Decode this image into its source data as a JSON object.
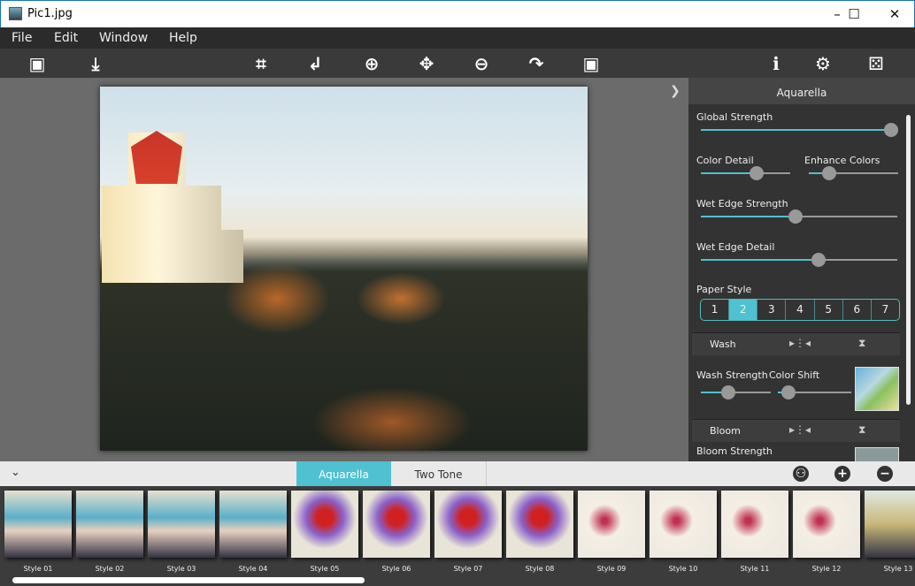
{
  "window": {
    "title": "Pic1.jpg",
    "minimize": "–",
    "maximize": "☐",
    "close": "✕"
  },
  "menu": [
    "File",
    "Edit",
    "Window",
    "Help"
  ],
  "toolbar": {
    "left": [
      {
        "icon": "open-image-icon",
        "glyph": "▣"
      },
      {
        "icon": "save-icon",
        "glyph": "⤓"
      }
    ],
    "center": [
      {
        "icon": "crop-icon",
        "glyph": "⌗"
      },
      {
        "icon": "undo-icon",
        "glyph": "↲"
      },
      {
        "icon": "zoom-in-icon",
        "glyph": "⊕"
      },
      {
        "icon": "pan-icon",
        "glyph": "✥"
      },
      {
        "icon": "zoom-out-icon",
        "glyph": "⊖"
      },
      {
        "icon": "redo-icon",
        "glyph": "↷"
      },
      {
        "icon": "fit-image-icon",
        "glyph": "▣"
      }
    ],
    "right": [
      {
        "icon": "info-icon",
        "glyph": "ℹ"
      },
      {
        "icon": "settings-icon",
        "glyph": "⚙"
      },
      {
        "icon": "random-dice-icon",
        "glyph": "⚄"
      }
    ]
  },
  "panel": {
    "title": "Aquarella",
    "sliders": {
      "global_strength": {
        "label": "Global Strength",
        "value": 0.97
      },
      "color_detail": {
        "label": "Color Detail",
        "value": 0.62
      },
      "enhance_colors": {
        "label": "Enhance Colors",
        "value": 0.23
      },
      "wet_edge_strength": {
        "label": "Wet Edge Strength",
        "value": 0.48
      },
      "wet_edge_detail": {
        "label": "Wet Edge Detail",
        "value": 0.6
      },
      "wash_strength": {
        "label": "Wash Strength",
        "value": 0.39
      },
      "color_shift": {
        "label": "Color Shift",
        "value": 0.14
      }
    },
    "paper_style": {
      "label": "Paper Style",
      "options": [
        "1",
        "2",
        "3",
        "4",
        "5",
        "6",
        "7"
      ],
      "selected": "2"
    },
    "wash_section": "Wash",
    "bloom_section": "Bloom",
    "bloom_strength": "Bloom Strength",
    "accent": "#4fc1d0"
  },
  "tabs": [
    {
      "label": "Aquarella",
      "active": true
    },
    {
      "label": "Two Tone",
      "active": false
    }
  ],
  "styles": [
    "Style 01",
    "Style 02",
    "Style 03",
    "Style 04",
    "Style 05",
    "Style 06",
    "Style 07",
    "Style 08",
    "Style 09",
    "Style 10",
    "Style 11",
    "Style 12",
    "Style 13"
  ]
}
